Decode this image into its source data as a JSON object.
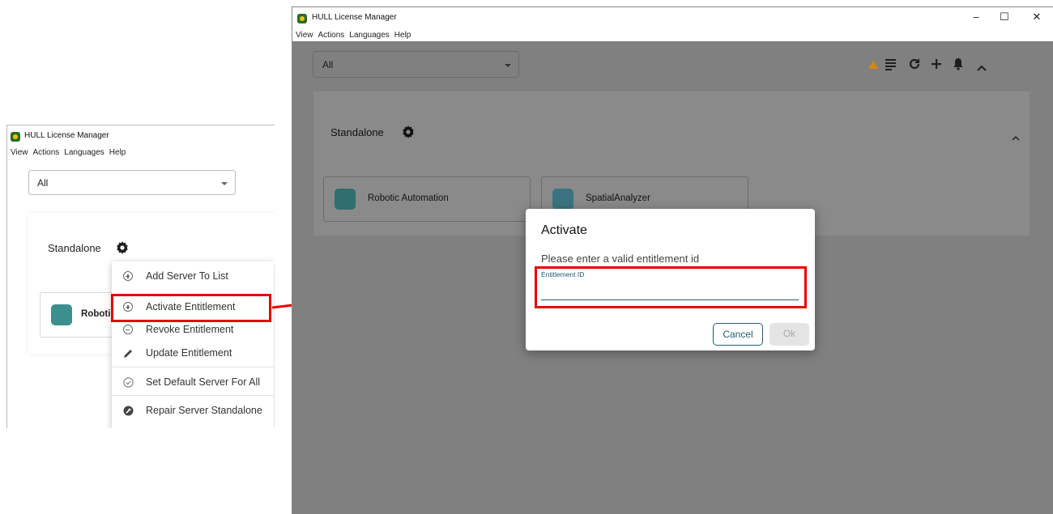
{
  "app": {
    "title": "HULL License Manager"
  },
  "menu": [
    "View",
    "Actions",
    "Languages",
    "Help"
  ],
  "filter": {
    "selected": "All"
  },
  "group": {
    "name": "Standalone"
  },
  "products": [
    {
      "name": "Robotic Automation",
      "truncated_name": "Roboti",
      "logo_color": "#3b8f8f"
    },
    {
      "name": "SpatialAnalyzer",
      "logo_color": "#4a9aa8"
    }
  ],
  "context_menu": {
    "items": [
      {
        "label": "Add Server To List",
        "icon": "plus-circle-icon"
      },
      {
        "label": "Activate Entitlement",
        "icon": "plus-circle-icon"
      },
      {
        "label": "Revoke Entitlement",
        "icon": "minus-circle-icon"
      },
      {
        "label": "Update Entitlement",
        "icon": "pencil-icon"
      },
      {
        "label": "Set Default Server For All",
        "icon": "check-circle-icon"
      },
      {
        "label": "Repair Server Standalone",
        "icon": "wrench-icon"
      }
    ]
  },
  "toolbar": {
    "icons": [
      "warning-icon",
      "list-icon",
      "refresh-icon",
      "add-icon",
      "bell-icon",
      "collapse-icon"
    ],
    "warning_color": "#d4880f"
  },
  "window_controls": {
    "minimize": "–",
    "maximize": "☐",
    "close": "✕"
  },
  "dialog": {
    "title": "Activate",
    "message": "Please enter a valid entitlement id",
    "field_label": "Entitlement ID",
    "field_value": "",
    "cancel_label": "Cancel",
    "ok_label": "Ok"
  },
  "colors": {
    "highlight": "#e60000",
    "accent": "#1f5c73"
  }
}
